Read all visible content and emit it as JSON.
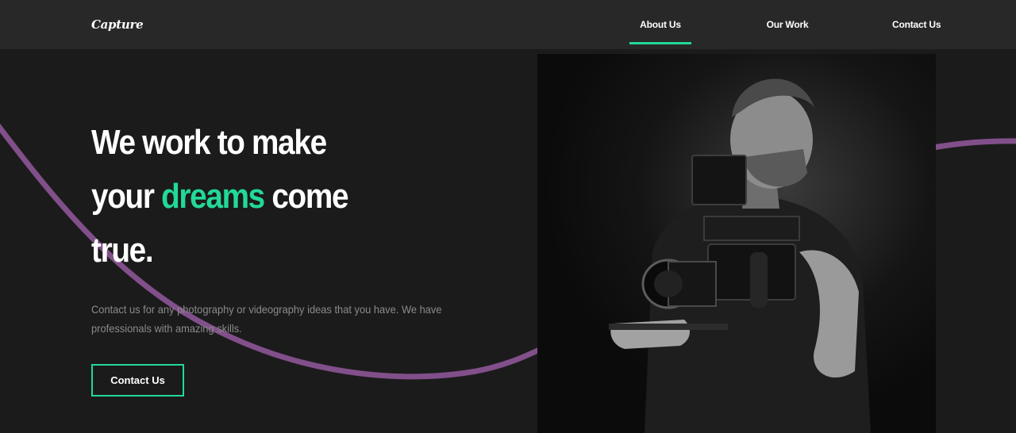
{
  "nav": {
    "logo": "Capture",
    "links": [
      {
        "label": "About Us",
        "active": true
      },
      {
        "label": "Our Work",
        "active": false
      },
      {
        "label": "Contact Us",
        "active": false
      }
    ]
  },
  "hero": {
    "title_line1": "We work to make",
    "title_line2_pre": "your ",
    "title_highlight": "dreams",
    "title_line2_post": " come",
    "title_line3": "true.",
    "description": "Contact us for any photography or videography ideas that you have. We have professionals with amazing skills.",
    "cta_label": "Contact Us"
  },
  "image": {
    "subject": "photographer-with-cinema-camera"
  },
  "colors": {
    "background": "#1b1b1b",
    "nav_background": "#282828",
    "accent": "#23d997",
    "curve": "#814f8a",
    "muted_text": "#8a8a8a"
  }
}
